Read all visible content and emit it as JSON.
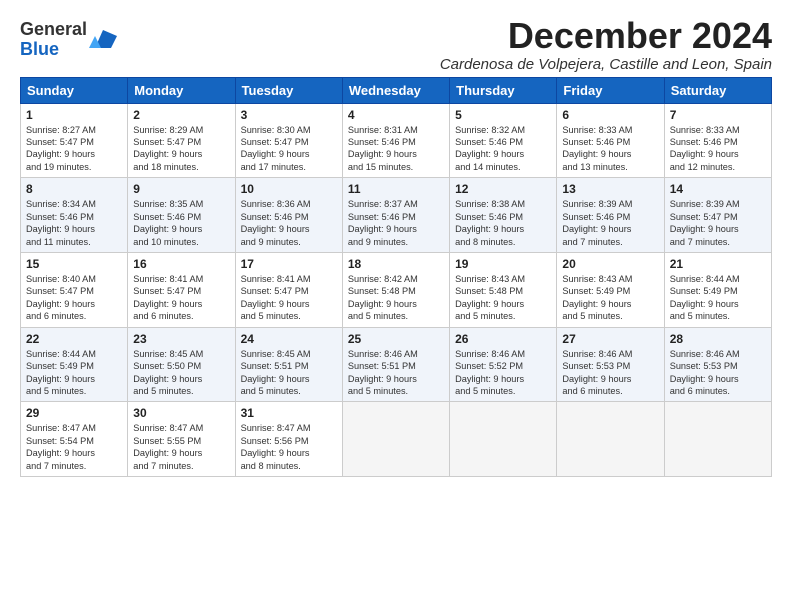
{
  "logo": {
    "general": "General",
    "blue": "Blue"
  },
  "title": "December 2024",
  "location": "Cardenosa de Volpejera, Castille and Leon, Spain",
  "days_header": [
    "Sunday",
    "Monday",
    "Tuesday",
    "Wednesday",
    "Thursday",
    "Friday",
    "Saturday"
  ],
  "weeks": [
    [
      {
        "day": "1",
        "lines": [
          "Sunrise: 8:27 AM",
          "Sunset: 5:47 PM",
          "Daylight: 9 hours",
          "and 19 minutes."
        ]
      },
      {
        "day": "2",
        "lines": [
          "Sunrise: 8:29 AM",
          "Sunset: 5:47 PM",
          "Daylight: 9 hours",
          "and 18 minutes."
        ]
      },
      {
        "day": "3",
        "lines": [
          "Sunrise: 8:30 AM",
          "Sunset: 5:47 PM",
          "Daylight: 9 hours",
          "and 17 minutes."
        ]
      },
      {
        "day": "4",
        "lines": [
          "Sunrise: 8:31 AM",
          "Sunset: 5:46 PM",
          "Daylight: 9 hours",
          "and 15 minutes."
        ]
      },
      {
        "day": "5",
        "lines": [
          "Sunrise: 8:32 AM",
          "Sunset: 5:46 PM",
          "Daylight: 9 hours",
          "and 14 minutes."
        ]
      },
      {
        "day": "6",
        "lines": [
          "Sunrise: 8:33 AM",
          "Sunset: 5:46 PM",
          "Daylight: 9 hours",
          "and 13 minutes."
        ]
      },
      {
        "day": "7",
        "lines": [
          "Sunrise: 8:33 AM",
          "Sunset: 5:46 PM",
          "Daylight: 9 hours",
          "and 12 minutes."
        ]
      }
    ],
    [
      {
        "day": "8",
        "lines": [
          "Sunrise: 8:34 AM",
          "Sunset: 5:46 PM",
          "Daylight: 9 hours",
          "and 11 minutes."
        ]
      },
      {
        "day": "9",
        "lines": [
          "Sunrise: 8:35 AM",
          "Sunset: 5:46 PM",
          "Daylight: 9 hours",
          "and 10 minutes."
        ]
      },
      {
        "day": "10",
        "lines": [
          "Sunrise: 8:36 AM",
          "Sunset: 5:46 PM",
          "Daylight: 9 hours",
          "and 9 minutes."
        ]
      },
      {
        "day": "11",
        "lines": [
          "Sunrise: 8:37 AM",
          "Sunset: 5:46 PM",
          "Daylight: 9 hours",
          "and 9 minutes."
        ]
      },
      {
        "day": "12",
        "lines": [
          "Sunrise: 8:38 AM",
          "Sunset: 5:46 PM",
          "Daylight: 9 hours",
          "and 8 minutes."
        ]
      },
      {
        "day": "13",
        "lines": [
          "Sunrise: 8:39 AM",
          "Sunset: 5:46 PM",
          "Daylight: 9 hours",
          "and 7 minutes."
        ]
      },
      {
        "day": "14",
        "lines": [
          "Sunrise: 8:39 AM",
          "Sunset: 5:47 PM",
          "Daylight: 9 hours",
          "and 7 minutes."
        ]
      }
    ],
    [
      {
        "day": "15",
        "lines": [
          "Sunrise: 8:40 AM",
          "Sunset: 5:47 PM",
          "Daylight: 9 hours",
          "and 6 minutes."
        ]
      },
      {
        "day": "16",
        "lines": [
          "Sunrise: 8:41 AM",
          "Sunset: 5:47 PM",
          "Daylight: 9 hours",
          "and 6 minutes."
        ]
      },
      {
        "day": "17",
        "lines": [
          "Sunrise: 8:41 AM",
          "Sunset: 5:47 PM",
          "Daylight: 9 hours",
          "and 5 minutes."
        ]
      },
      {
        "day": "18",
        "lines": [
          "Sunrise: 8:42 AM",
          "Sunset: 5:48 PM",
          "Daylight: 9 hours",
          "and 5 minutes."
        ]
      },
      {
        "day": "19",
        "lines": [
          "Sunrise: 8:43 AM",
          "Sunset: 5:48 PM",
          "Daylight: 9 hours",
          "and 5 minutes."
        ]
      },
      {
        "day": "20",
        "lines": [
          "Sunrise: 8:43 AM",
          "Sunset: 5:49 PM",
          "Daylight: 9 hours",
          "and 5 minutes."
        ]
      },
      {
        "day": "21",
        "lines": [
          "Sunrise: 8:44 AM",
          "Sunset: 5:49 PM",
          "Daylight: 9 hours",
          "and 5 minutes."
        ]
      }
    ],
    [
      {
        "day": "22",
        "lines": [
          "Sunrise: 8:44 AM",
          "Sunset: 5:49 PM",
          "Daylight: 9 hours",
          "and 5 minutes."
        ]
      },
      {
        "day": "23",
        "lines": [
          "Sunrise: 8:45 AM",
          "Sunset: 5:50 PM",
          "Daylight: 9 hours",
          "and 5 minutes."
        ]
      },
      {
        "day": "24",
        "lines": [
          "Sunrise: 8:45 AM",
          "Sunset: 5:51 PM",
          "Daylight: 9 hours",
          "and 5 minutes."
        ]
      },
      {
        "day": "25",
        "lines": [
          "Sunrise: 8:46 AM",
          "Sunset: 5:51 PM",
          "Daylight: 9 hours",
          "and 5 minutes."
        ]
      },
      {
        "day": "26",
        "lines": [
          "Sunrise: 8:46 AM",
          "Sunset: 5:52 PM",
          "Daylight: 9 hours",
          "and 5 minutes."
        ]
      },
      {
        "day": "27",
        "lines": [
          "Sunrise: 8:46 AM",
          "Sunset: 5:53 PM",
          "Daylight: 9 hours",
          "and 6 minutes."
        ]
      },
      {
        "day": "28",
        "lines": [
          "Sunrise: 8:46 AM",
          "Sunset: 5:53 PM",
          "Daylight: 9 hours",
          "and 6 minutes."
        ]
      }
    ],
    [
      {
        "day": "29",
        "lines": [
          "Sunrise: 8:47 AM",
          "Sunset: 5:54 PM",
          "Daylight: 9 hours",
          "and 7 minutes."
        ]
      },
      {
        "day": "30",
        "lines": [
          "Sunrise: 8:47 AM",
          "Sunset: 5:55 PM",
          "Daylight: 9 hours",
          "and 7 minutes."
        ]
      },
      {
        "day": "31",
        "lines": [
          "Sunrise: 8:47 AM",
          "Sunset: 5:56 PM",
          "Daylight: 9 hours",
          "and 8 minutes."
        ]
      },
      null,
      null,
      null,
      null
    ]
  ]
}
